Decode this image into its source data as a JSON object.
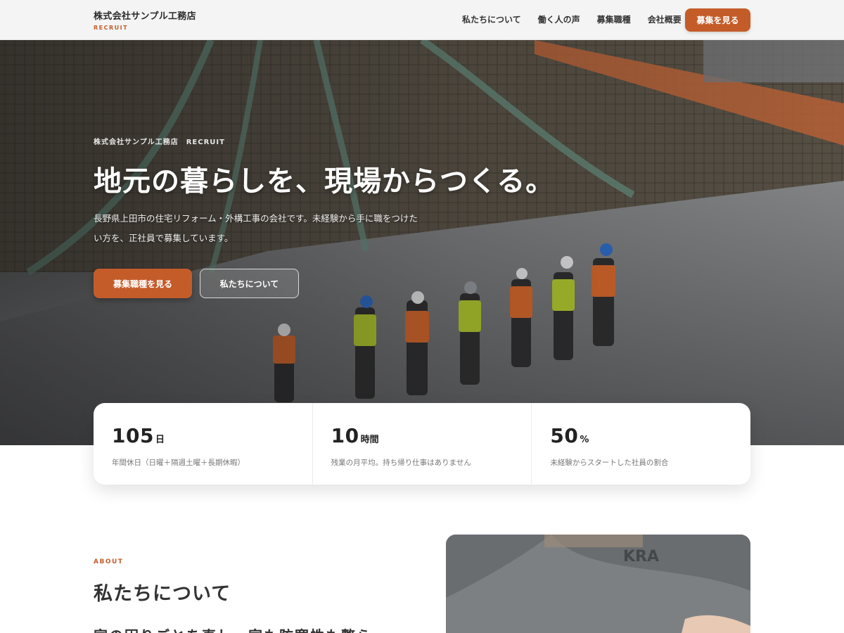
{
  "header": {
    "company": "株式会社サンプル工務店",
    "sub": "RECRUIT",
    "nav": [
      "私たちについて",
      "働く人の声",
      "募集職種",
      "会社概要"
    ],
    "cta": "募集を見る"
  },
  "hero": {
    "kicker": "株式会社サンプル工務店　RECRUIT",
    "title": "地元の暮らしを、現場からつくる。",
    "lead": "長野県上田市の住宅リフォーム・外構工事の会社です。未経験から手に職をつけたい方を、正社員で募集しています。",
    "primary_button": "募集職種を見る",
    "secondary_button": "私たちについて"
  },
  "stats": [
    {
      "value": "105",
      "unit": "日",
      "desc": "年間休日（日曜＋隔週土曜＋長期休暇）"
    },
    {
      "value": "10",
      "unit": "時間",
      "desc": "残業の月平均。持ち帰り仕事はありません"
    },
    {
      "value": "50",
      "unit": "%",
      "desc": "未経験からスタートした社員の割合"
    }
  ],
  "about": {
    "kicker": "ABOUT",
    "title": "私たちについて",
    "lead": "家の困りごとを直し、家も防寒性も整ら"
  },
  "colors": {
    "accent": "#c45c2a",
    "text": "#2b2b2b"
  },
  "icons": {
    "hero_photo": "construction-site-photo",
    "about_photo": "worker-photo"
  }
}
